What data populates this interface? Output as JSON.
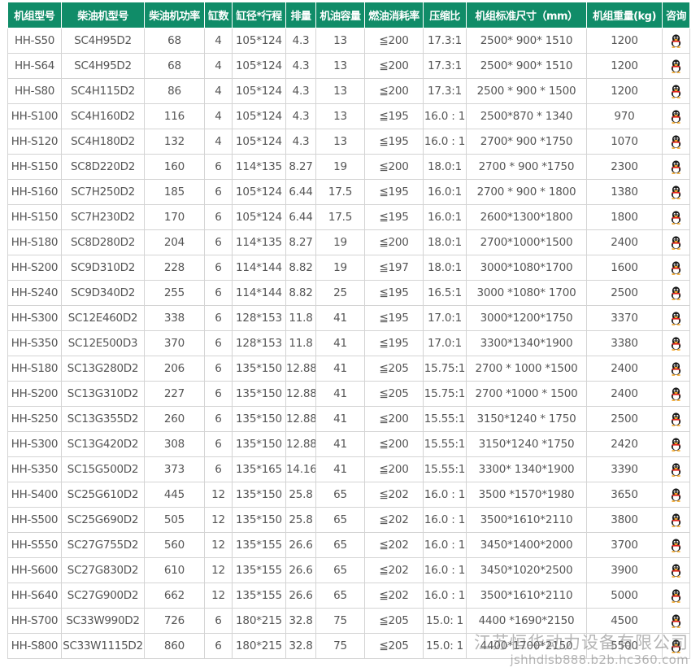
{
  "headers": [
    "机组型号",
    "柴油机型号",
    "柴油机功率",
    "缸数",
    "缸径*行程",
    "排量",
    "机油容量",
    "燃油消耗率",
    "压缩比",
    "机组标准尺寸（mm）",
    "机组重量(kg)",
    "咨询"
  ],
  "rows": [
    [
      "HH-S50",
      "SC4H95D2",
      "68",
      "4",
      "105*124",
      "4.3",
      "13",
      "≦200",
      "17.3:1",
      "2500* 900* 1510",
      "1200"
    ],
    [
      "HH-S64",
      "SC4H95D2",
      "68",
      "4",
      "105*124",
      "4.3",
      "13",
      "≦200",
      "17.3:1",
      "2500* 900* 1510",
      "1200"
    ],
    [
      "HH-S80",
      "SC4H115D2",
      "86",
      "4",
      "105*124",
      "4.3",
      "13",
      "≦200",
      "17.3:1",
      "2500 * 900 * 1500",
      "1200"
    ],
    [
      "HH-S100",
      "SC4H160D2",
      "116",
      "4",
      "105*124",
      "4.3",
      "13",
      "≦195",
      "16.0 : 1",
      "2500*870 * 1340",
      "970"
    ],
    [
      "HH-S120",
      "SC4H180D2",
      "132",
      "4",
      "105*124",
      "4.3",
      "13",
      "≦195",
      "16.0 : 1",
      "2700* 900 *1750",
      "1070"
    ],
    [
      "HH-S150",
      "SC8D220D2",
      "160",
      "6",
      "114*135",
      "8.27",
      "19",
      "≦200",
      "18.0:1",
      "2700 * 900 *1750",
      "2300"
    ],
    [
      "HH-S160",
      "SC7H250D2",
      "185",
      "6",
      "105*124",
      "6.44",
      "17.5",
      "≦195",
      "16.0:1",
      "2700 * 900 * 1800",
      "1380"
    ],
    [
      "HH-S150",
      "SC7H230D2",
      "170",
      "6",
      "105*124",
      "6.44",
      "17.5",
      "≦195",
      "16.0:1",
      "2600*1300*1800",
      "1800"
    ],
    [
      "HH-S180",
      "SC8D280D2",
      "204",
      "6",
      "114*135",
      "8.27",
      "19",
      "≦200",
      "18.0:1",
      "2700*1000*1500",
      "2400"
    ],
    [
      "HH-S200",
      "SC9D310D2",
      "228",
      "6",
      "114*144",
      "8.82",
      "19",
      "≦197",
      "18.0:1",
      "3000*1080*1700",
      "1600"
    ],
    [
      "HH-S240",
      "SC9D340D2",
      "255",
      "6",
      "114*144",
      "8.82",
      "25",
      "≦195",
      "16.5:1",
      "3000 *1080* 1700",
      "2500"
    ],
    [
      "HH-S300",
      "SC12E460D2",
      "338",
      "6",
      "128*153",
      "11.8",
      "41",
      "≦195",
      "17.0:1",
      "3000*1200*1750",
      "3370"
    ],
    [
      "HH-S350",
      "SC12E500D3",
      "370",
      "6",
      "128*153",
      "11.8",
      "41",
      "≦195",
      "17.0:1",
      "3300*1340*1900",
      "3380"
    ],
    [
      "HH-S180",
      "SC13G280D2",
      "206",
      "6",
      "135*150",
      "12.88",
      "41",
      "≦205",
      "15.75:1",
      "2700 * 1000 *1500",
      "2400"
    ],
    [
      "HH-S200",
      "SC13G310D2",
      "227",
      "6",
      "135*150",
      "12.88",
      "41",
      "≦205",
      "15.75:1",
      "2700 *1000 * 1500",
      "2400"
    ],
    [
      "HH-S250",
      "SC13G355D2",
      "260",
      "6",
      "135*150",
      "12.88",
      "41",
      "≦200",
      "15.55:1",
      "3150*1240 * 1750",
      "2500"
    ],
    [
      "HH-S300",
      "SC13G420D2",
      "308",
      "6",
      "135*150",
      "12.88",
      "41",
      "≦200",
      "15.55:1",
      "3150*1240 *1750",
      "2420"
    ],
    [
      "HH-S350",
      "SC15G500D2",
      "373",
      "6",
      "135*165",
      "14.16",
      "41",
      "≦200",
      "15.55:1",
      "3300* 1340*1900",
      "3390"
    ],
    [
      "HH-S400",
      "SC25G610D2",
      "445",
      "12",
      "135*150",
      "25.8",
      "65",
      "≦202",
      "16.0 : 1",
      "3500 *1570*1980",
      "3650"
    ],
    [
      "HH-S500",
      "SC25G690D2",
      "505",
      "12",
      "135*150",
      "25.8",
      "65",
      "≦202",
      "16.0 : 1",
      "3500*1610*2110",
      "3800"
    ],
    [
      "HH-S550",
      "SC27G755D2",
      "560",
      "12",
      "135*155",
      "26.6",
      "65",
      "≦202",
      "16.0 : 1",
      "3450*1400*2000",
      "3700"
    ],
    [
      "HH-S600",
      "SC27G830D2",
      "610",
      "12",
      "135*155",
      "26.6",
      "65",
      "≦202",
      "16.0 : 1",
      "3450*1020*2500",
      "3900"
    ],
    [
      "HH-S640",
      "SC27G900D2",
      "662",
      "12",
      "135*155",
      "26.6",
      "65",
      "≦202",
      "16.0 : 1",
      "3500*1610*2110",
      "5000"
    ],
    [
      "HH-S700",
      "SC33W990D2",
      "726",
      "6",
      "180*215",
      "32.8",
      "75",
      "≦205",
      "15.0: 1",
      "4400 *1690*2150",
      "4500"
    ],
    [
      "HH-S800",
      "SC33W1115D2",
      "860",
      "6",
      "180*215",
      "32.8",
      "75",
      "≦205",
      "15.0: 1",
      "4400*1700*2150",
      "5500"
    ]
  ],
  "watermark": {
    "company": "江苏恒华动力设备有限公司",
    "url": "jshhdlsb888.b2b.hc360.com"
  },
  "colors": {
    "header_bg": "#108c68",
    "header_text": "#ffffff",
    "body_text": "#555555",
    "grid": "#d4d4d4"
  },
  "icons": {
    "consult": "qq-penguin-icon"
  }
}
